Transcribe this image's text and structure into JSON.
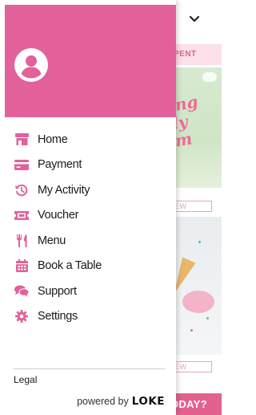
{
  "background": {
    "partial_tab_label": "PENT",
    "view_button_label": "IEW",
    "cta_label": "ODAY?",
    "promo_text": "ing\nly\nm"
  },
  "drawer": {
    "header_color": "#e2619b",
    "accent_color": "#e2619b",
    "menu": [
      {
        "label": "Home",
        "icon": "store-icon"
      },
      {
        "label": "Payment",
        "icon": "credit-card-icon"
      },
      {
        "label": "My Activity",
        "icon": "history-icon"
      },
      {
        "label": "Voucher",
        "icon": "ticket-icon"
      },
      {
        "label": "Menu",
        "icon": "utensils-icon"
      },
      {
        "label": "Book a Table",
        "icon": "calendar-icon"
      },
      {
        "label": "Support",
        "icon": "chat-bubbles-icon"
      },
      {
        "label": "Settings",
        "icon": "gear-icon"
      }
    ],
    "legal_label": "Legal",
    "powered_by_label": "powered by",
    "powered_by_brand": "LOKE"
  }
}
